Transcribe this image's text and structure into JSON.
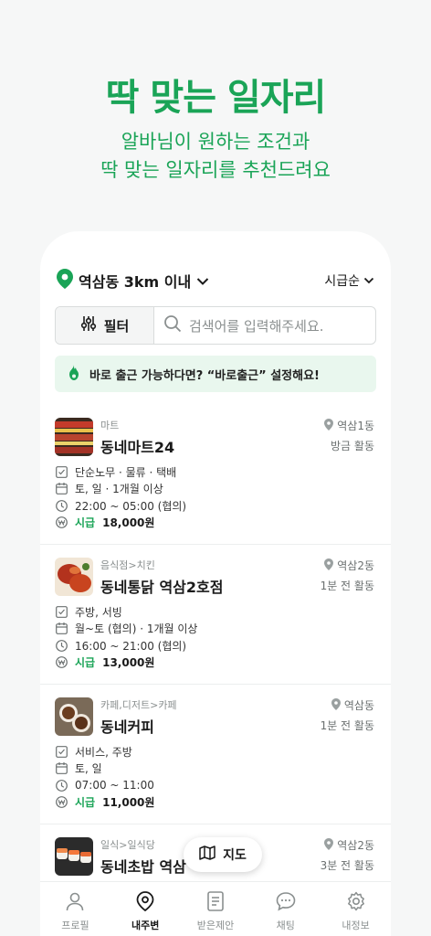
{
  "hero": {
    "title": "딱 맞는 일자리",
    "subtitle_line1": "알바님이 원하는 조건과",
    "subtitle_line2": "딱 맞는 일자리를 추천드려요"
  },
  "location": {
    "label": "역삼동 3km 이내"
  },
  "sort": {
    "label": "시급순"
  },
  "search": {
    "filter_label": "필터",
    "placeholder": "검색어를 입력해주세요."
  },
  "notice": {
    "text": "바로 출근 가능하다면? “바로출근” 설정해요!"
  },
  "jobs": [
    {
      "category": "마트",
      "name": "동네마트24",
      "area": "역삼1동",
      "active": "방금 활동",
      "work": "단순노무 · 물류 · 택배",
      "days": "토, 일 · 1개월 이상",
      "time": "22:00 ~ 05:00 (협의)",
      "wage_label": "시급",
      "wage": "18,000원"
    },
    {
      "category": "음식점>치킨",
      "name": "동네통닭 역삼2호점",
      "area": "역삼2동",
      "active": "1분 전 활동",
      "work": "주방, 서빙",
      "days": "월~토 (협의) · 1개월 이상",
      "time": "16:00 ~ 21:00 (협의)",
      "wage_label": "시급",
      "wage": "13,000원"
    },
    {
      "category": "카페,디저트>카페",
      "name": "동네커피",
      "area": "역삼동",
      "active": "1분 전 활동",
      "work": "서비스, 주방",
      "days": "토, 일",
      "time": "07:00 ~ 11:00",
      "wage_label": "시급",
      "wage": "11,000원"
    },
    {
      "category": "일식>일식당",
      "name": "동네초밥 역삼",
      "area": "역삼2동",
      "active": "3분 전 활동"
    }
  ],
  "map_button": {
    "label": "지도"
  },
  "tabs": [
    {
      "label": "프로필",
      "icon": "person-icon"
    },
    {
      "label": "내주변",
      "icon": "location-pin-icon"
    },
    {
      "label": "받은제안",
      "icon": "document-icon"
    },
    {
      "label": "채팅",
      "icon": "chat-icon"
    },
    {
      "label": "내정보",
      "icon": "gear-icon"
    }
  ],
  "colors": {
    "brand": "#1aa457",
    "notice_bg": "#e9f7ee"
  }
}
